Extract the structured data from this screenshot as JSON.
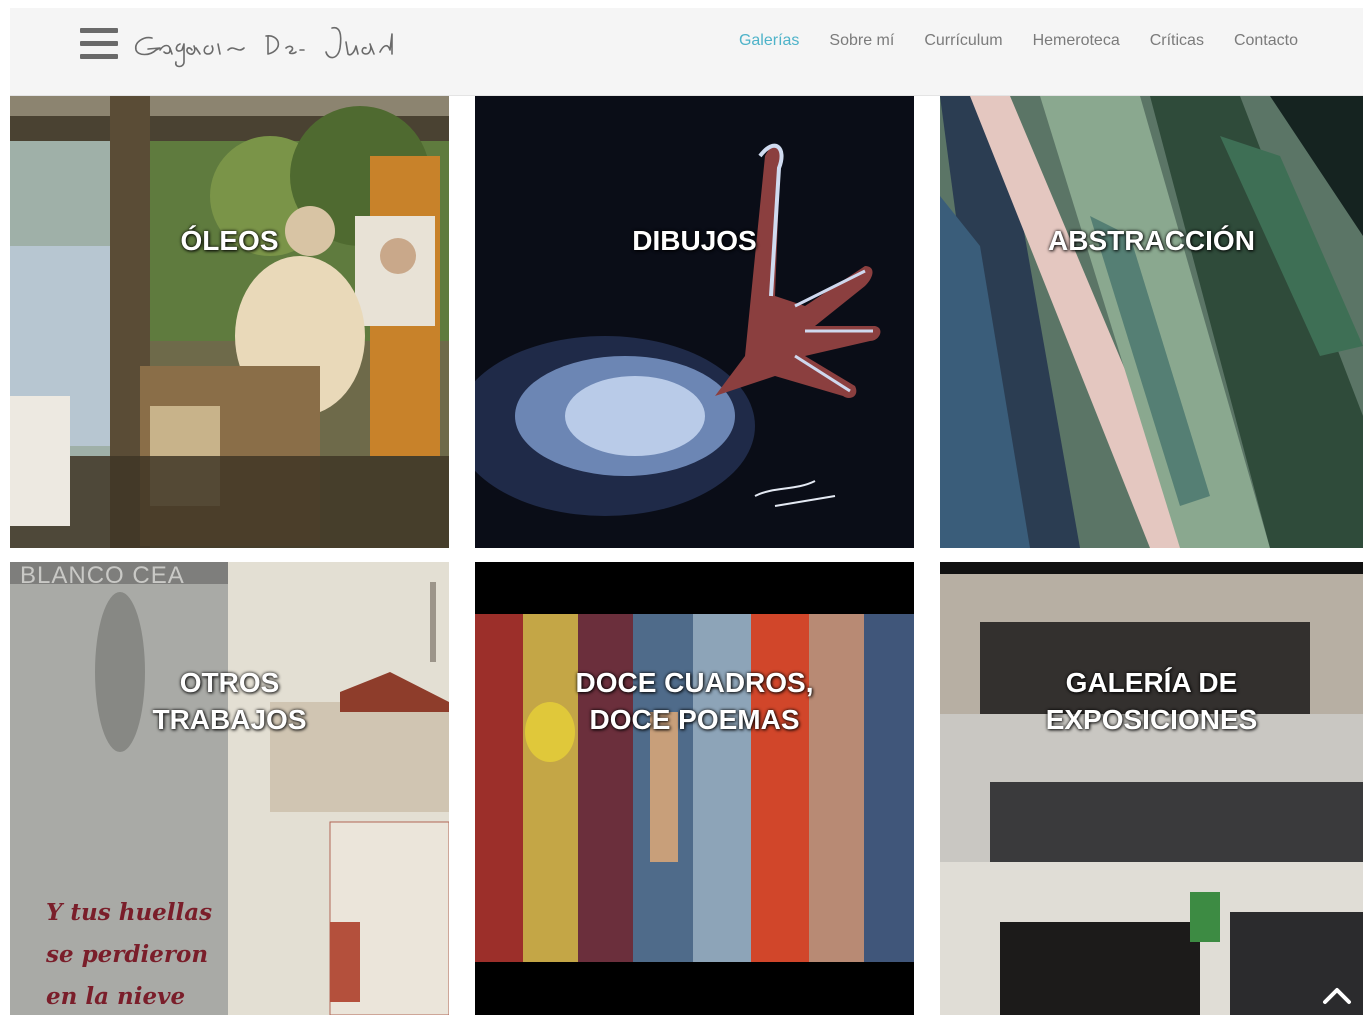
{
  "header": {
    "logo_alt": "García de Juan",
    "nav": [
      {
        "label": "Galerías",
        "active": true
      },
      {
        "label": "Sobre mí",
        "active": false
      },
      {
        "label": "Currículum",
        "active": false
      },
      {
        "label": "Hemeroteca",
        "active": false
      },
      {
        "label": "Críticas",
        "active": false
      },
      {
        "label": "Contacto",
        "active": false
      }
    ]
  },
  "galleries": [
    {
      "title_line1": "ÓLEOS",
      "title_line2": ""
    },
    {
      "title_line1": "DIBUJOS",
      "title_line2": ""
    },
    {
      "title_line1": "ABSTRACCIÓN",
      "title_line2": ""
    },
    {
      "title_line1": "OTROS",
      "title_line2": "TRABAJOS",
      "image_text_top": "BLANCO CEA",
      "image_text_bottom": [
        "Y tus huellas",
        "se perdieron",
        "en la nieve"
      ]
    },
    {
      "title_line1": "DOCE CUADROS,",
      "title_line2": "DOCE POEMAS"
    },
    {
      "title_line1": "GALERÍA DE",
      "title_line2": "EXPOSICIONES"
    }
  ],
  "colors": {
    "nav_active": "#4eb3c9",
    "nav_default": "#7b7b7b",
    "header_bg": "#f5f5f5"
  }
}
